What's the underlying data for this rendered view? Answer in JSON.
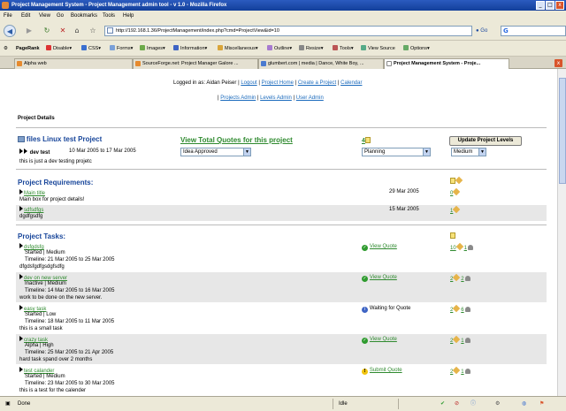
{
  "window": {
    "title": "Project Management System - Project Management admin tool - v 1.0 - Mozilla Firefox",
    "controls": [
      "_",
      "□",
      "x"
    ]
  },
  "menu": [
    "File",
    "Edit",
    "View",
    "Go",
    "Bookmarks",
    "Tools",
    "Help"
  ],
  "nav": {
    "url": "http://192.168.1.36/ProjectManagement/index.php?cmd=ProjectView&id=10",
    "go_label": "Go",
    "search_glyph": "G"
  },
  "devbar": {
    "items": [
      "Disable▾",
      "CSS▾",
      "Forms▾",
      "Images▾",
      "Information▾",
      "Miscellaneous▾",
      "Outline▾",
      "Resize▾",
      "Tools▾",
      "View Source",
      "Options▾"
    ],
    "pagerank": "PageRank"
  },
  "tabs": [
    {
      "label": "Alpha web"
    },
    {
      "label": "SourceForge.net: Project Manager Galore ..."
    },
    {
      "label": "glumbert.com | media | Dance, White Boy, ..."
    },
    {
      "label": "Project Management System - Proje..."
    }
  ],
  "header": {
    "logged_in_prefix": "Logged in as:",
    "user": "Aidan Peiser",
    "links_row1": [
      "Logout",
      "Project Home",
      "Create a Project",
      "Calendar"
    ],
    "links_row2": [
      "Projects Admin",
      "Levels Admin",
      "User Admin"
    ],
    "separator": "|"
  },
  "project_details_label": "Project Details",
  "project": {
    "name": "files Linux test Project",
    "quotes_link": "View Total Quotes for this project",
    "quote_count": "4",
    "update_button": "Update Project Levels",
    "dev_name": "dev test",
    "dates": "10 Mar 2005 to 17 Mar 2005",
    "description": "this is just a dev testing projetc",
    "status_select": "Idea Approved",
    "phase_select": "Planning",
    "priority_select": "Medium"
  },
  "requirements": {
    "heading": "Project Requirements:",
    "items": [
      {
        "title": "Main title",
        "desc": "Main box for project details!",
        "date": "29 Mar 2005",
        "count": "0"
      },
      {
        "title": "sdfsdfgs",
        "desc": "dgdfgsdfg",
        "date": "15 Mar 2005",
        "count": "1"
      }
    ]
  },
  "tasks": {
    "heading": "Project Tasks:",
    "timeline_prefix": "Timeline:",
    "items": [
      {
        "title": "dsfgdsfg",
        "status": "Started | Medium",
        "timeline": "21 Mar 2005 to 25 Mar 2005",
        "desc": "dfgdsfgdfgsdgfsdfg",
        "quote": "View Quote",
        "quote_type": "ok",
        "notes": "10",
        "users": "1"
      },
      {
        "title": "dev on new server",
        "status": "Inactive | Medium",
        "timeline": "14 Mar 2005 to 16 Mar 2005",
        "desc": "work to be done on the new server.",
        "quote": "View Quote",
        "quote_type": "ok",
        "notes": "2",
        "users": "2"
      },
      {
        "title": "easy task",
        "status": "Started | Low",
        "timeline": "18 Mar 2005 to 11 Mar 2005",
        "desc": "this is a small task",
        "quote": "Waiting for Quote",
        "quote_type": "info",
        "notes": "2",
        "users": "6"
      },
      {
        "title": "crazy task",
        "status": "Alpha | High",
        "timeline": "25 Mar 2005 to 21 Apr 2005",
        "desc": "hard task spand over 2 months",
        "quote": "View Quote",
        "quote_type": "ok",
        "notes": "2",
        "users": "1"
      },
      {
        "title": "test calander",
        "status": "Started | Medium",
        "timeline": "23 Mar 2005 to 30 Mar 2005",
        "desc": "this is a test for the calender",
        "quote": "Submit Quote",
        "quote_type": "warn",
        "notes": "2",
        "users": "1"
      }
    ]
  },
  "status": {
    "left": "Done",
    "idle": "Idle"
  },
  "colors": {
    "link_green": "#2f8a2f",
    "heading_blue": "#17459a",
    "band_gray": "#e7e7e7"
  }
}
